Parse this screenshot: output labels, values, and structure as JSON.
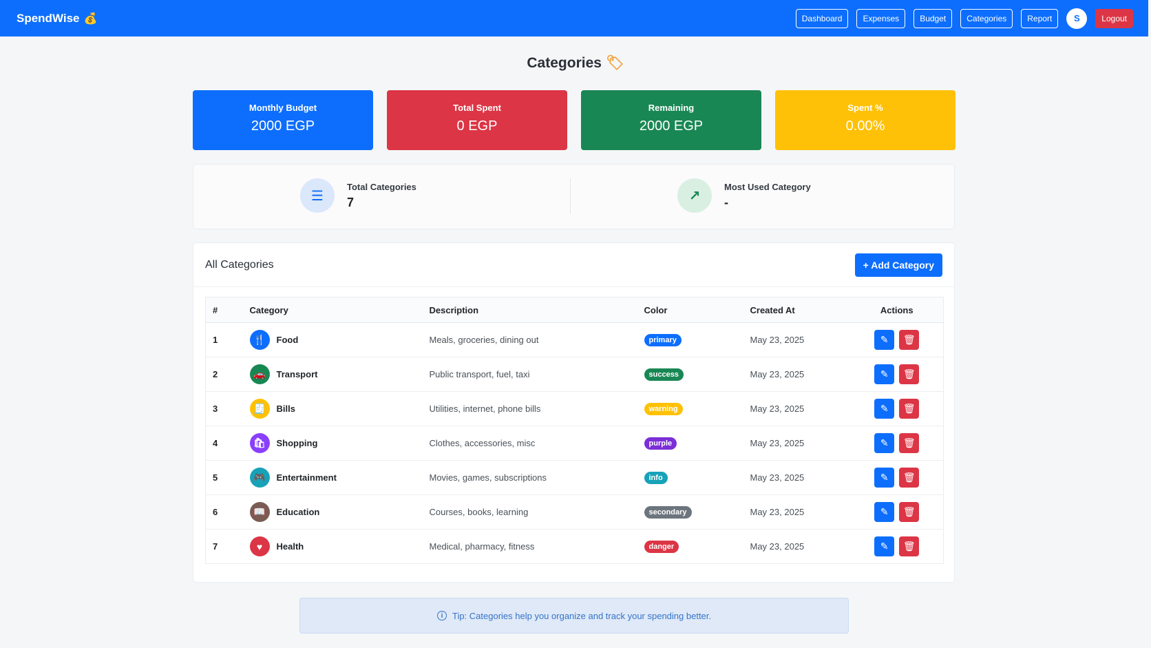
{
  "brand": {
    "name": "SpendWise",
    "icon": "money-bag-icon"
  },
  "nav": {
    "items": [
      {
        "label": "Dashboard"
      },
      {
        "label": "Expenses"
      },
      {
        "label": "Budget"
      },
      {
        "label": "Categories"
      },
      {
        "label": "Report"
      }
    ],
    "avatar": "S",
    "logout": "Logout"
  },
  "page": {
    "title": "Categories",
    "title_icon": "tag-icon"
  },
  "stats": [
    {
      "label": "Monthly Budget",
      "value": "2000 EGP",
      "color": "#0d6efd"
    },
    {
      "label": "Total Spent",
      "value": "0 EGP",
      "color": "#dc3545"
    },
    {
      "label": "Remaining",
      "value": "2000 EGP",
      "color": "#198754"
    },
    {
      "label": "Spent %",
      "value": "0.00%",
      "color": "#ffc107"
    }
  ],
  "summary": {
    "total": {
      "label": "Total Categories",
      "value": "7",
      "icon": "list-icon"
    },
    "most_used": {
      "label": "Most Used Category",
      "value": "-",
      "icon": "trend-up-icon"
    }
  },
  "categories_card": {
    "title": "All Categories",
    "add_button": "+ Add Category",
    "columns": [
      "#",
      "Category",
      "Description",
      "Color",
      "Created At",
      "Actions"
    ],
    "rows": [
      {
        "num": "1",
        "name": "Food",
        "icon": "utensils-icon",
        "icon_glyph": "🍴",
        "icon_color": "#0d6efd",
        "description": "Meals, groceries, dining out",
        "color": "primary",
        "badge_color": "#0d6efd",
        "created": "May 23, 2025"
      },
      {
        "num": "2",
        "name": "Transport",
        "icon": "car-icon",
        "icon_glyph": "🚗",
        "icon_color": "#198754",
        "description": "Public transport, fuel, taxi",
        "color": "success",
        "badge_color": "#198754",
        "created": "May 23, 2025"
      },
      {
        "num": "3",
        "name": "Bills",
        "icon": "receipt-icon",
        "icon_glyph": "🧾",
        "icon_color": "#ffc107",
        "description": "Utilities, internet, phone bills",
        "color": "warning",
        "badge_color": "#ffc107",
        "created": "May 23, 2025"
      },
      {
        "num": "4",
        "name": "Shopping",
        "icon": "shopping-bag-icon",
        "icon_glyph": "🛍",
        "icon_color": "#8a3ffc",
        "description": "Clothes, accessories, misc",
        "color": "purple",
        "badge_color": "#7b2fd6",
        "created": "May 23, 2025"
      },
      {
        "num": "5",
        "name": "Entertainment",
        "icon": "gamepad-icon",
        "icon_glyph": "🎮",
        "icon_color": "#17a2b8",
        "description": "Movies, games, subscriptions",
        "color": "info",
        "badge_color": "#17a2b8",
        "created": "May 23, 2025"
      },
      {
        "num": "6",
        "name": "Education",
        "icon": "book-icon",
        "icon_glyph": "📖",
        "icon_color": "#7a5c53",
        "description": "Courses, books, learning",
        "color": "secondary",
        "badge_color": "#6c757d",
        "created": "May 23, 2025"
      },
      {
        "num": "7",
        "name": "Health",
        "icon": "heart-icon",
        "icon_glyph": "♥",
        "icon_color": "#dc3545",
        "description": "Medical, pharmacy, fitness",
        "color": "danger",
        "badge_color": "#dc3545",
        "created": "May 23, 2025"
      }
    ]
  },
  "tip": {
    "text": "Tip: Categories help you organize and track your spending better.",
    "icon": "info-icon"
  }
}
